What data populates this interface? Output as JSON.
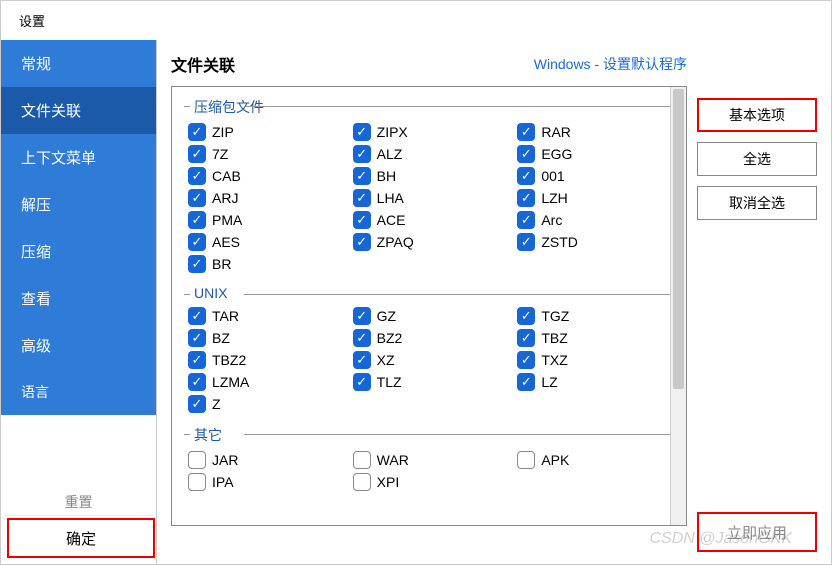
{
  "window": {
    "title": "设置"
  },
  "sidebar": {
    "items": [
      {
        "label": "常规",
        "active": false
      },
      {
        "label": "文件关联",
        "active": true
      },
      {
        "label": "上下文菜单",
        "active": false
      },
      {
        "label": "解压",
        "active": false
      },
      {
        "label": "压缩",
        "active": false
      },
      {
        "label": "查看",
        "active": false
      },
      {
        "label": "高级",
        "active": false
      }
    ],
    "language_label": "语言",
    "reset_label": "重置",
    "ok_label": "确定"
  },
  "main": {
    "title": "文件关联",
    "link": "Windows - 设置默认程序",
    "groups": [
      {
        "title": "压缩包文件",
        "items": [
          {
            "label": "ZIP",
            "checked": true
          },
          {
            "label": "ZIPX",
            "checked": true
          },
          {
            "label": "RAR",
            "checked": true
          },
          {
            "label": "7Z",
            "checked": true
          },
          {
            "label": "ALZ",
            "checked": true
          },
          {
            "label": "EGG",
            "checked": true
          },
          {
            "label": "CAB",
            "checked": true
          },
          {
            "label": "BH",
            "checked": true
          },
          {
            "label": "001",
            "checked": true
          },
          {
            "label": "ARJ",
            "checked": true
          },
          {
            "label": "LHA",
            "checked": true
          },
          {
            "label": "LZH",
            "checked": true
          },
          {
            "label": "PMA",
            "checked": true
          },
          {
            "label": "ACE",
            "checked": true
          },
          {
            "label": "Arc",
            "checked": true
          },
          {
            "label": "AES",
            "checked": true
          },
          {
            "label": "ZPAQ",
            "checked": true
          },
          {
            "label": "ZSTD",
            "checked": true
          },
          {
            "label": "BR",
            "checked": true
          }
        ]
      },
      {
        "title": "UNIX",
        "items": [
          {
            "label": "TAR",
            "checked": true
          },
          {
            "label": "GZ",
            "checked": true
          },
          {
            "label": "TGZ",
            "checked": true
          },
          {
            "label": "BZ",
            "checked": true
          },
          {
            "label": "BZ2",
            "checked": true
          },
          {
            "label": "TBZ",
            "checked": true
          },
          {
            "label": "TBZ2",
            "checked": true
          },
          {
            "label": "XZ",
            "checked": true
          },
          {
            "label": "TXZ",
            "checked": true
          },
          {
            "label": "LZMA",
            "checked": true
          },
          {
            "label": "TLZ",
            "checked": true
          },
          {
            "label": "LZ",
            "checked": true
          },
          {
            "label": "Z",
            "checked": true
          }
        ]
      },
      {
        "title": "其它",
        "items": [
          {
            "label": "JAR",
            "checked": false
          },
          {
            "label": "WAR",
            "checked": false
          },
          {
            "label": "APK",
            "checked": false
          },
          {
            "label": "IPA",
            "checked": false
          },
          {
            "label": "XPI",
            "checked": false
          }
        ]
      }
    ],
    "side_buttons": {
      "basic": "基本选项",
      "select_all": "全选",
      "deselect_all": "取消全选",
      "apply": "立即应用"
    }
  },
  "watermark": "CSDN @JasonGKK"
}
